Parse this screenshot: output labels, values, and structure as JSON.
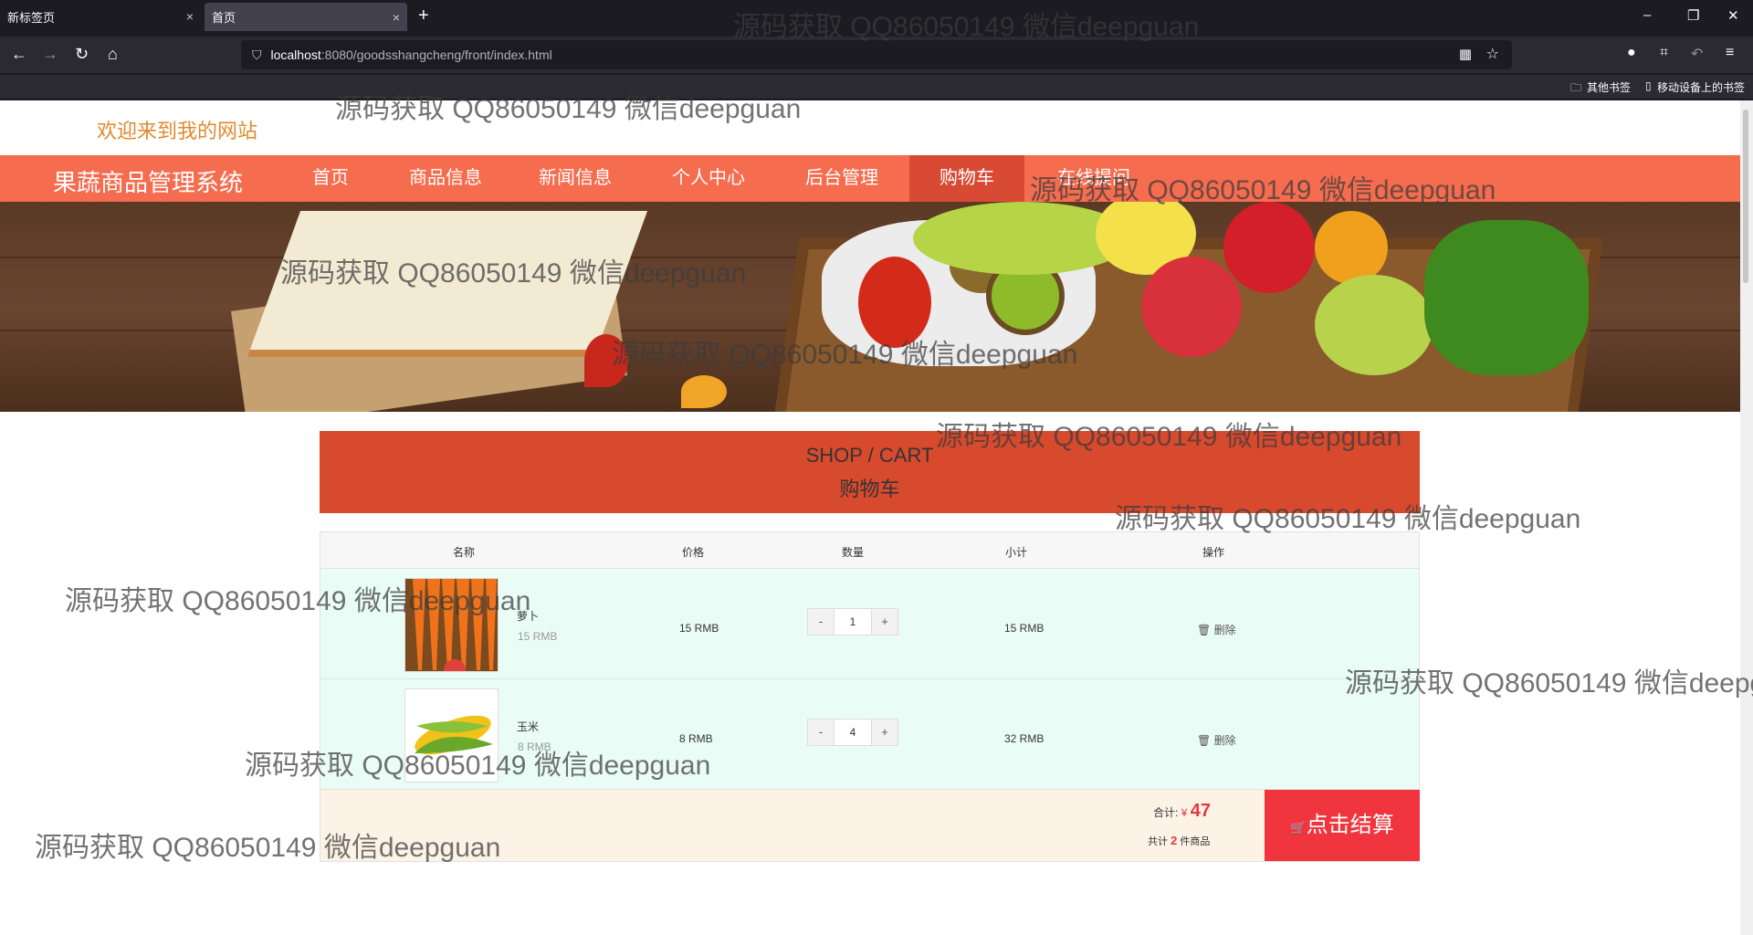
{
  "browser": {
    "tabs": [
      {
        "title": "新标签页",
        "close": "×"
      },
      {
        "title": "首页",
        "close": "×"
      }
    ],
    "new_tab": "+",
    "window_controls": [
      "–",
      "❐",
      "✕"
    ],
    "nav": {
      "back": "←",
      "forward": "→",
      "reload": "↻",
      "home": "⌂"
    },
    "url_host": "localhost",
    "url_path": ":8080/goodsshangcheng/front/index.html",
    "bookmarks": [
      {
        "label": "其他书签"
      },
      {
        "label": "移动设备上的书签"
      }
    ]
  },
  "site": {
    "welcome": "欢迎来到我的网站",
    "brand": "果蔬商品管理系统",
    "nav": [
      {
        "label": "首页"
      },
      {
        "label": "商品信息"
      },
      {
        "label": "新闻信息"
      },
      {
        "label": "个人中心"
      },
      {
        "label": "后台管理"
      },
      {
        "label": "购物车"
      },
      {
        "label": "在线提问"
      }
    ],
    "active_nav": "购物车",
    "accent": "#f56c4f",
    "active_color": "#d94a35"
  },
  "cart": {
    "heading_en": "SHOP / CART",
    "heading_zh": "购物车",
    "columns": [
      "名称",
      "价格",
      "数量",
      "小计",
      "操作"
    ],
    "items": [
      {
        "name": "萝卜",
        "unit_price": "15 RMB",
        "price": "15 RMB",
        "qty": "1",
        "subtotal": "15 RMB",
        "action": "删除",
        "minus": "-",
        "plus": "+"
      },
      {
        "name": "玉米",
        "unit_price": "8 RMB",
        "price": "8 RMB",
        "qty": "4",
        "subtotal": "32 RMB",
        "action": "删除",
        "minus": "-",
        "plus": "+"
      }
    ],
    "total_label": "合计:",
    "currency": "¥",
    "total": "47",
    "count_prefix": "共计",
    "count": "2",
    "count_suffix": "件商品",
    "checkout": "点击结算"
  },
  "watermark": "源码获取 QQ86050149 微信deepguan"
}
